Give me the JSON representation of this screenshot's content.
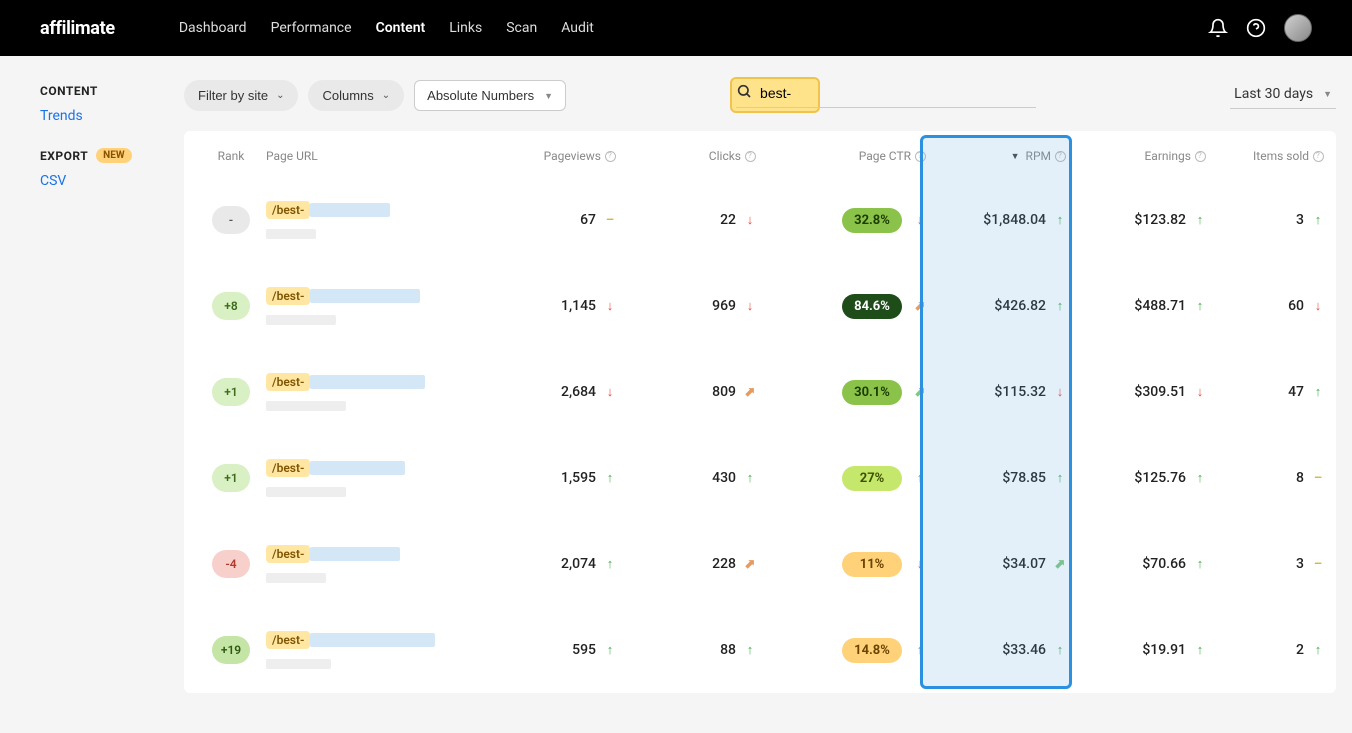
{
  "brand": "affilimate",
  "nav": {
    "dashboard": "Dashboard",
    "performance": "Performance",
    "content": "Content",
    "links": "Links",
    "scan": "Scan",
    "audit": "Audit"
  },
  "sidebar": {
    "content_heading": "CONTENT",
    "trends": "Trends",
    "export_heading": "EXPORT",
    "new_badge": "NEW",
    "csv": "CSV"
  },
  "toolbar": {
    "filter_by_site": "Filter by site",
    "columns": "Columns",
    "absolute_numbers": "Absolute Numbers",
    "search_value": "best-",
    "date_range": "Last 30 days"
  },
  "columns": {
    "rank": "Rank",
    "page_url": "Page URL",
    "pageviews": "Pageviews",
    "clicks": "Clicks",
    "page_ctr": "Page CTR",
    "rpm": "RPM",
    "earnings": "Earnings",
    "items_sold": "Items sold"
  },
  "rows": [
    {
      "rank": "-",
      "rank_style": "rank-gray",
      "url": "/best-",
      "bar_blue": 80,
      "bar_gray": 50,
      "pageviews": "67",
      "pv_trend": "flat",
      "clicks": "22",
      "clicks_trend": "down",
      "ctr": "32.8%",
      "ctr_style": "ctr-green",
      "ctr_trend": "down",
      "rpm": "$1,848.04",
      "rpm_trend": "up",
      "earnings": "$123.82",
      "earn_trend": "up",
      "items": "3",
      "items_trend": "up"
    },
    {
      "rank": "+8",
      "rank_style": "rank-green",
      "url": "/best-",
      "bar_blue": 110,
      "bar_gray": 70,
      "pageviews": "1,145",
      "pv_trend": "down",
      "clicks": "969",
      "clicks_trend": "down",
      "ctr": "84.6%",
      "ctr_style": "ctr-darkgreen",
      "ctr_trend": "diag",
      "rpm": "$426.82",
      "rpm_trend": "up",
      "earnings": "$488.71",
      "earn_trend": "up",
      "items": "60",
      "items_trend": "down"
    },
    {
      "rank": "+1",
      "rank_style": "rank-green",
      "url": "/best-",
      "bar_blue": 115,
      "bar_gray": 80,
      "pageviews": "2,684",
      "pv_trend": "down",
      "clicks": "809",
      "clicks_trend": "diag",
      "ctr": "30.1%",
      "ctr_style": "ctr-green",
      "ctr_trend": "up2",
      "rpm": "$115.32",
      "rpm_trend": "down",
      "earnings": "$309.51",
      "earn_trend": "down",
      "items": "47",
      "items_trend": "up"
    },
    {
      "rank": "+1",
      "rank_style": "rank-green",
      "url": "/best-",
      "bar_blue": 95,
      "bar_gray": 80,
      "pageviews": "1,595",
      "pv_trend": "up",
      "clicks": "430",
      "clicks_trend": "up",
      "ctr": "27%",
      "ctr_style": "ctr-lime",
      "ctr_trend": "up",
      "rpm": "$78.85",
      "rpm_trend": "up",
      "earnings": "$125.76",
      "earn_trend": "up",
      "items": "8",
      "items_trend": "flat"
    },
    {
      "rank": "-4",
      "rank_style": "rank-red",
      "url": "/best-",
      "bar_blue": 90,
      "bar_gray": 60,
      "pageviews": "2,074",
      "pv_trend": "up",
      "clicks": "228",
      "clicks_trend": "diag",
      "ctr": "11%",
      "ctr_style": "ctr-yellow",
      "ctr_trend": "down",
      "rpm": "$34.07",
      "rpm_trend": "up2",
      "earnings": "$70.66",
      "earn_trend": "up",
      "items": "3",
      "items_trend": "flat"
    },
    {
      "rank": "+19",
      "rank_style": "rank-darkgreen",
      "url": "/best-",
      "bar_blue": 125,
      "bar_gray": 65,
      "pageviews": "595",
      "pv_trend": "up",
      "clicks": "88",
      "clicks_trend": "up",
      "ctr": "14.8%",
      "ctr_style": "ctr-yellow",
      "ctr_trend": "up",
      "rpm": "$33.46",
      "rpm_trend": "up",
      "earnings": "$19.91",
      "earn_trend": "up",
      "items": "2",
      "items_trend": "up"
    }
  ]
}
